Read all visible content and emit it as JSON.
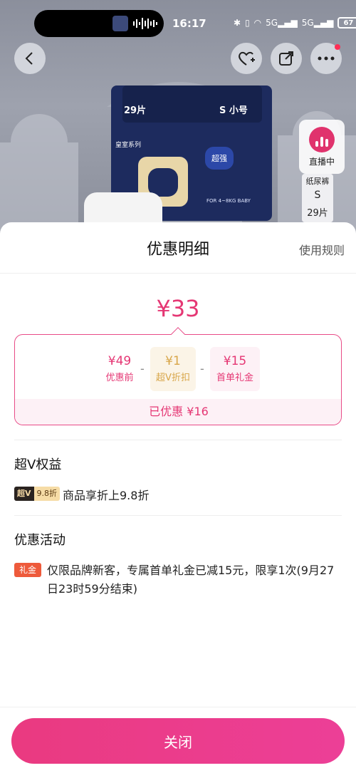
{
  "status_bar": {
    "time": "16:17",
    "battery": "67",
    "network_1": "5G",
    "network_2": "5G"
  },
  "product": {
    "bag_size_left": "29片",
    "bag_size_right": "S 小号",
    "bag_series": "皇室系列",
    "bag_strong": "超强",
    "bag_baby": "FOR 4~8KG BABY",
    "live_label": "直播中",
    "spec_type": "纸尿裤",
    "spec_size": "S",
    "spec_count": "29片"
  },
  "sheet": {
    "title": "优惠明细",
    "rules_link": "使用规则",
    "total_price": "¥33",
    "calc": {
      "items": [
        {
          "value": "¥49",
          "label": "优惠前"
        },
        {
          "value": "¥1",
          "label": "超V折扣"
        },
        {
          "value": "¥15",
          "label": "首单礼金"
        }
      ],
      "minus": "-",
      "saved": "已优惠 ¥16"
    },
    "svip": {
      "title": "超V权益",
      "tag_main": "超V",
      "tag_discount": "9.8折",
      "desc": "商品享折上9.8折"
    },
    "promo": {
      "title": "优惠活动",
      "tag": "礼金",
      "desc": "仅限品牌新客，专属首单礼金已减15元，限享1次(9月27日23时59分结束)"
    },
    "close_button": "关闭"
  },
  "colors": {
    "accent": "#e53774",
    "svip_dark": "#2a2320",
    "svip_gold": "#f6dca6",
    "gift_tag": "#ee5a3b"
  }
}
